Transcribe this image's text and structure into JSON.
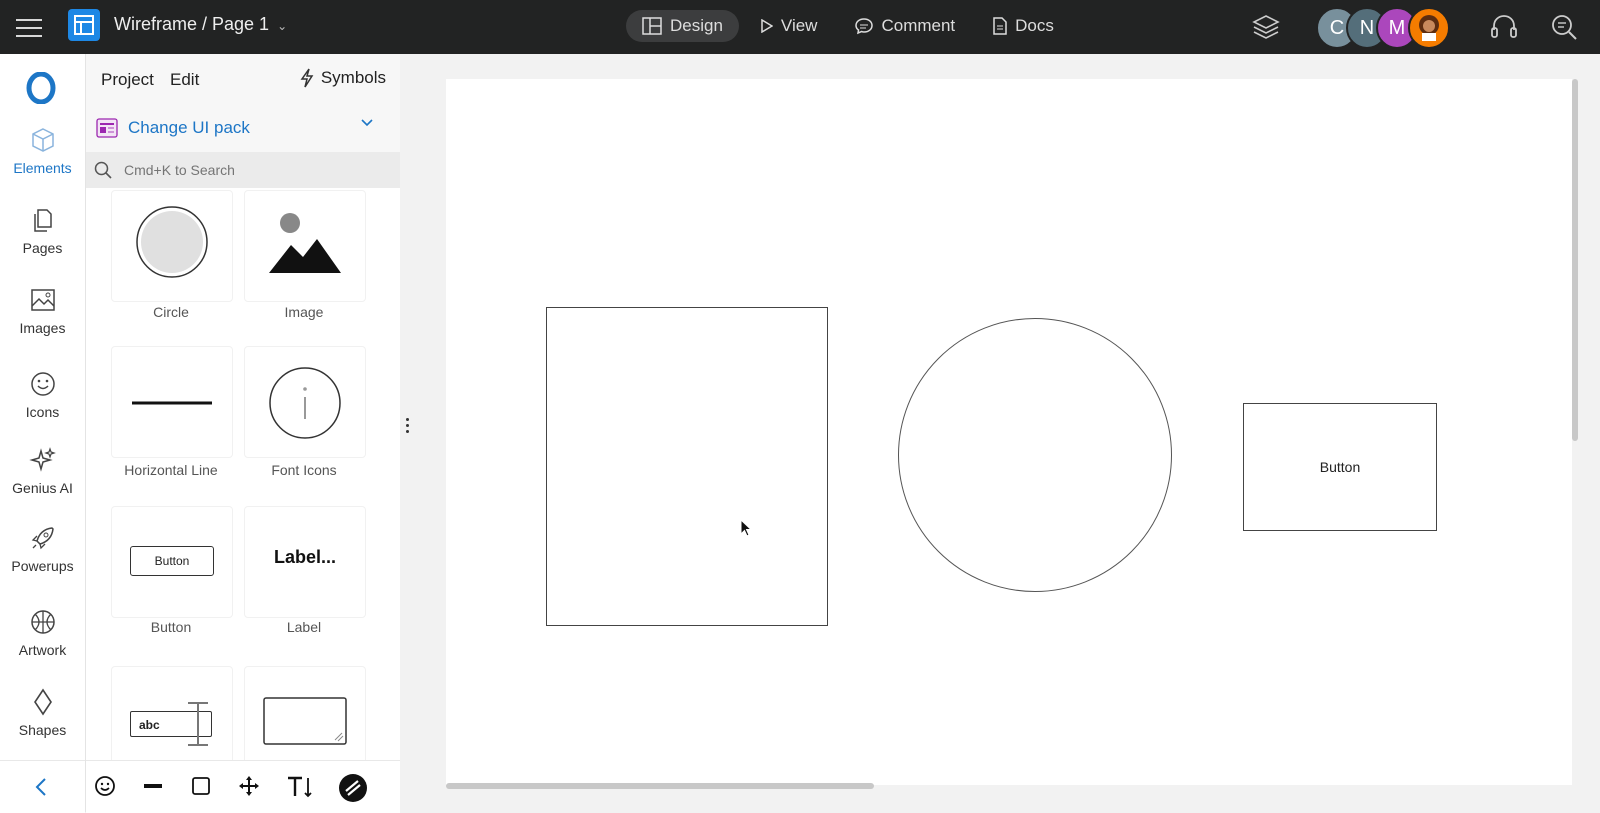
{
  "header": {
    "doc_title": "Wireframe / Page 1",
    "modes": [
      {
        "label": "Design",
        "icon": "layout-icon",
        "active": true
      },
      {
        "label": "View",
        "icon": "play-icon"
      },
      {
        "label": "Comment",
        "icon": "comment-icon"
      },
      {
        "label": "Docs",
        "icon": "doc-icon"
      }
    ],
    "avatars": [
      {
        "initial": "C",
        "color": "#78909c"
      },
      {
        "initial": "N",
        "color": "#546e7a"
      },
      {
        "initial": "M",
        "color": "#ab47bc"
      },
      {
        "initial": "",
        "color": "#f57c00"
      }
    ]
  },
  "rail": {
    "items": [
      {
        "label": "Elements",
        "icon": "cube-icon",
        "active": true
      },
      {
        "label": "Pages",
        "icon": "pages-icon"
      },
      {
        "label": "Images",
        "icon": "image-icon"
      },
      {
        "label": "Icons",
        "icon": "smiley-icon"
      },
      {
        "label": "Genius AI",
        "icon": "sparkle-icon"
      },
      {
        "label": "Powerups",
        "icon": "rocket-icon"
      },
      {
        "label": "Artwork",
        "icon": "globe-icon"
      },
      {
        "label": "Shapes",
        "icon": "diamond-icon"
      }
    ]
  },
  "panel": {
    "tab_project": "Project",
    "tab_edit": "Edit",
    "symbols": "Symbols",
    "ui_pack": "Change UI pack",
    "search_placeholder": "Cmd+K to Search",
    "tiles": [
      {
        "label": "Circle"
      },
      {
        "label": "Image"
      },
      {
        "label": "Horizontal Line"
      },
      {
        "label": "Font Icons"
      },
      {
        "label": "Button",
        "preview_text": "Button"
      },
      {
        "label": "Label",
        "preview_text": "Label..."
      },
      {
        "label": "",
        "preview_text": "abc"
      },
      {
        "label": ""
      }
    ]
  },
  "canvas": {
    "button_label": "Button"
  },
  "colors": {
    "accent": "#1d76c6",
    "topbar": "#222323"
  }
}
